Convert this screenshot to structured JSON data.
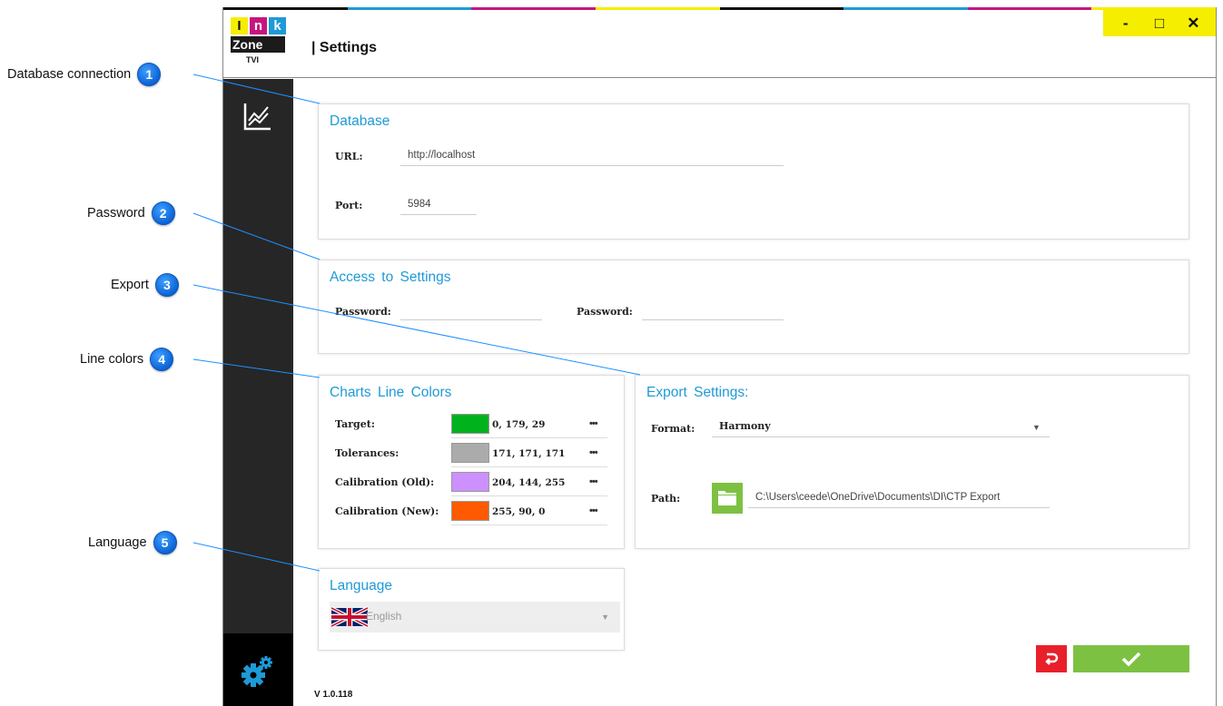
{
  "callouts": [
    {
      "label": "Database connection",
      "num": "1"
    },
    {
      "label": "Password",
      "num": "2"
    },
    {
      "label": "Export",
      "num": "3"
    },
    {
      "label": "Line colors",
      "num": "4"
    },
    {
      "label": "Language",
      "num": "5"
    }
  ],
  "app": {
    "title": "| Settings",
    "version": "V 1.0.118",
    "logo": {
      "letters": [
        "I",
        "n",
        "k"
      ],
      "zone": "Zone",
      "tvi": "TVI"
    },
    "window_controls": {
      "minimize": "-",
      "maximize": "□",
      "close": "✕"
    },
    "strip_colors": [
      "#111111",
      "#1e9ad6",
      "#c7157f",
      "#f5ee00",
      "#111111",
      "#1e9ad6",
      "#c7157f",
      "#f5ee00"
    ]
  },
  "database": {
    "title": "Database",
    "url_label": "URL:",
    "url_value": "http://localhost",
    "port_label": "Port:",
    "port_value": "5984"
  },
  "access": {
    "title": "Access  to  Settings",
    "password1_label": "Password:",
    "password1_value": "",
    "password2_label": "Password:",
    "password2_value": ""
  },
  "line_colors": {
    "title": "Charts  Line  Colors",
    "rows": [
      {
        "label": "Target:",
        "rgb": "0, 179, 29",
        "color": "#00b31d"
      },
      {
        "label": "Tolerances:",
        "rgb": "171, 171, 171",
        "color": "#ababab"
      },
      {
        "label": "Calibration (Old):",
        "rgb": "204, 144, 255",
        "color": "#cc90ff"
      },
      {
        "label": "Calibration (New):",
        "rgb": "255, 90, 0",
        "color": "#ff5a00"
      }
    ],
    "more": "•••"
  },
  "export": {
    "title": "Export  Settings:",
    "format_label": "Format:",
    "format_value": "Harmony",
    "path_label": "Path:",
    "path_value": "C:\\Users\\ceede\\OneDrive\\Documents\\DI\\CTP Export"
  },
  "language": {
    "title": "Language",
    "selected": "English"
  },
  "colors": {
    "accent": "#1e9ad6",
    "confirm": "#7dc142",
    "revert": "#e8202a",
    "sidebar": "#262626"
  }
}
